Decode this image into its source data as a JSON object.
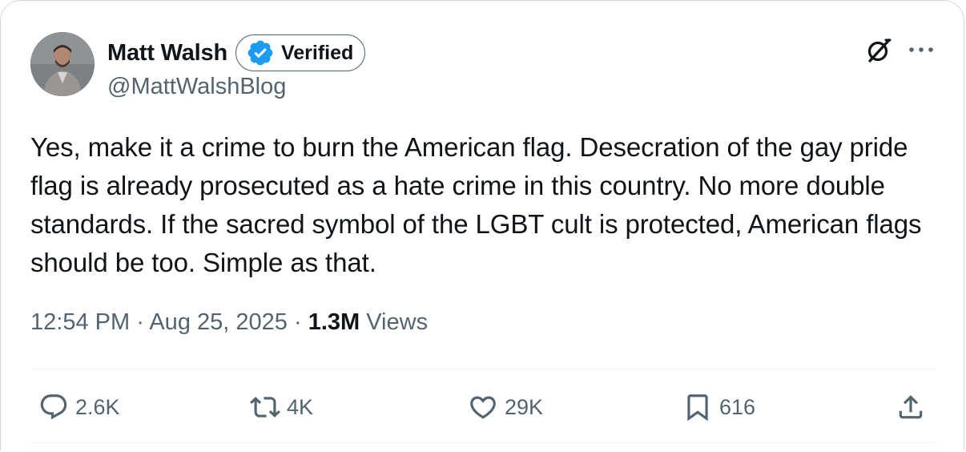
{
  "author": {
    "display_name": "Matt Walsh",
    "verified_label": "Verified",
    "handle": "@MattWalshBlog"
  },
  "tweet": {
    "text": "Yes, make it a crime to burn the American flag. Desecration of the gay pride flag is already prosecuted as a hate crime in this country. No more double standards. If the sacred symbol of the LGBT cult is protected, American flags should be too. Simple as that.",
    "time": "12:54 PM",
    "separator": "·",
    "date": "Aug 25, 2025",
    "views_count": "1.3M",
    "views_label": "Views"
  },
  "actions": {
    "replies": "2.6K",
    "reposts": "4K",
    "likes": "29K",
    "bookmarks": "616"
  },
  "colors": {
    "text_primary": "#0f1419",
    "text_secondary": "#536471",
    "verified_blue": "#1d9bf0",
    "border": "#cfd9de"
  },
  "icons": {
    "grok": "grok-icon",
    "more": "more-icon",
    "reply": "reply-icon",
    "repost": "repost-icon",
    "like": "heart-icon",
    "bookmark": "bookmark-icon",
    "share": "share-icon",
    "verified": "verified-badge-icon"
  }
}
